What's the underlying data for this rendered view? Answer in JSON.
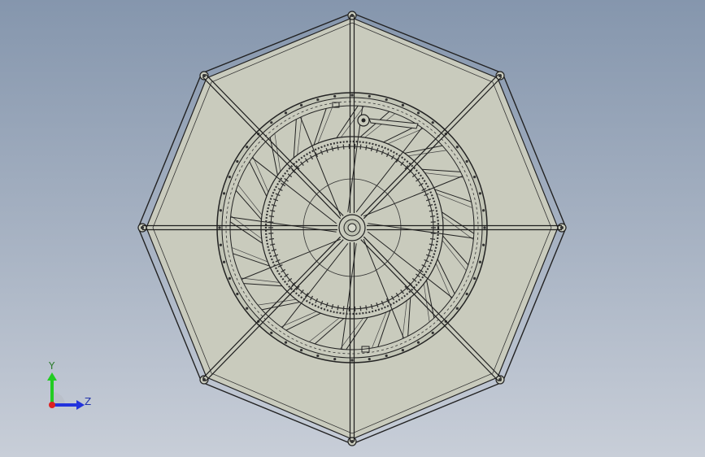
{
  "viewport": {
    "background_top": "#8596ad",
    "background_bottom": "#c8ced8"
  },
  "model": {
    "fill_color": "#c9cbbd",
    "line_color": "#1e1e1e"
  },
  "triad": {
    "y_label": "Y",
    "z_label": "Z",
    "y_color": "#22cc22",
    "z_color": "#2233dd",
    "x_color": "#dd2222"
  }
}
